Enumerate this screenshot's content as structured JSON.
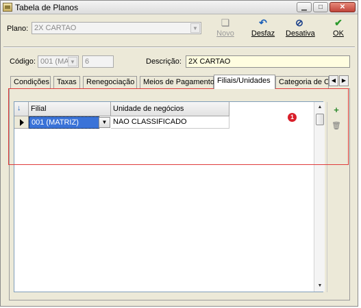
{
  "window": {
    "title": "Tabela de Planos",
    "buttons": {
      "minimize": "▁",
      "maximize": "□",
      "close": "✕"
    }
  },
  "plano": {
    "label": "Plano:",
    "value": "2X CARTAO",
    "arrow": "▼"
  },
  "toolbar": {
    "novo": {
      "label": "Novo",
      "icon": "new-doc-icon",
      "glyph": "❏"
    },
    "desfaz": {
      "label": "Desfaz",
      "icon": "undo-icon",
      "glyph": "↶"
    },
    "desativa": {
      "label": "Desativa",
      "icon": "disable-icon",
      "glyph": "⊘"
    },
    "ok": {
      "label": "OK",
      "icon": "check-icon",
      "glyph": "✔"
    }
  },
  "codigo": {
    "label": "Código:",
    "value": "001 (MA",
    "arrow": "▼",
    "number": "6"
  },
  "descricao": {
    "label": "Descrição:",
    "value": "2X CARTAO"
  },
  "tabs": [
    {
      "label": "Condições"
    },
    {
      "label": "Taxas"
    },
    {
      "label": "Renegociação"
    },
    {
      "label": "Meios de Pagamento"
    },
    {
      "label": "Filiais/Unidades",
      "active": true
    },
    {
      "label": "Categoria de C"
    }
  ],
  "tab_scroll": {
    "left": "◀",
    "right": "▶"
  },
  "grid": {
    "columns": [
      "Filial",
      "Unidade de negócios"
    ],
    "rows": [
      {
        "filial": "001 (MATRIZ)",
        "unidade": "NAO CLASSIFICADO"
      }
    ],
    "drop_arrow": "▼",
    "scroll_up": "▲",
    "scroll_down": "▼",
    "header_icon": "↓"
  },
  "side_tools": {
    "add": {
      "icon": "add-row-icon",
      "glyph": "+"
    },
    "delete": {
      "icon": "trash-icon",
      "glyph": "🗑"
    }
  },
  "annotation": {
    "badge": "1"
  },
  "colors": {
    "window_bg": "#ece9d8",
    "selection": "#3a73d8",
    "yellow_field": "#fffde0",
    "highlight_border": "#e03a3a",
    "badge": "#d91f2a"
  }
}
